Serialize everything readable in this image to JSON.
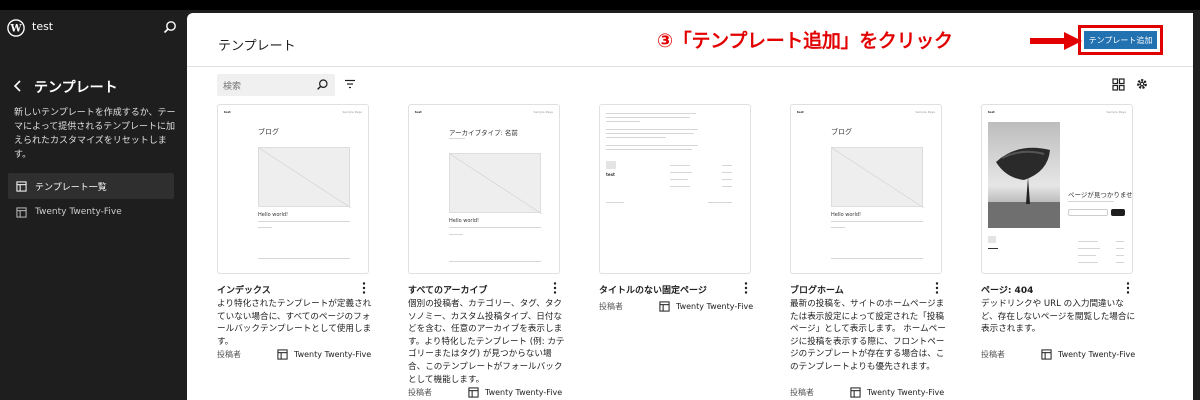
{
  "sidebar": {
    "site_name": "test",
    "title": "テンプレート",
    "description": "新しいテンプレートを作成するか、テーマによって提供されるテンプレートに加えられたカスタマイズをリセットします。",
    "nav": [
      {
        "label": "テンプレート一覧"
      },
      {
        "label": "Twenty Twenty-Five"
      }
    ]
  },
  "header": {
    "title": "テンプレート",
    "annotation": "③「テンプレート追加」をクリック",
    "add_button": "テンプレート追加"
  },
  "toolbar": {
    "search_placeholder": "検索"
  },
  "colors": {
    "accent": "#2271b1",
    "annotation_red": "#e30000",
    "sidebar_bg": "#1e1e1e"
  },
  "cards": [
    {
      "title": "インデックス",
      "description": "より特化されたテンプレートが定義されていない場合に、すべてのページのフォールバックテンプレートとして使用します。",
      "author": "投稿者",
      "theme": "Twenty Twenty-Five",
      "preview": {
        "site": "test",
        "nav": "Sample Page",
        "heading": "ブログ",
        "post_title": "Hello world!"
      }
    },
    {
      "title": "すべてのアーカイブ",
      "description": "個別の投稿者、カテゴリー、タグ、タクソノミー、カスタム投稿タイプ、日付などを含む、任意のアーカイブを表示します。より特化したテンプレート (例: カテゴリーまたはタグ) が見つからない場合、このテンプレートがフォールバックとして機能します。",
      "author": "投稿者",
      "theme": "Twenty Twenty-Five",
      "preview": {
        "site": "test",
        "nav": "Sample Page",
        "heading": "アーカイブタイプ: 名前",
        "post_title": "Hello world!"
      }
    },
    {
      "title": "タイトルのない固定ページ",
      "description": "",
      "author": "投稿者",
      "theme": "Twenty Twenty-Five",
      "preview": {
        "site": "test"
      }
    },
    {
      "title": "ブログホーム",
      "description": "最新の投稿を、サイトのホームページまたは表示設定によって設定された「投稿ページ」として表示します。 ホームページに投稿を表示する際に、フロントページのテンプレートが存在する場合は、このテンプレートよりも優先されます。",
      "author": "投稿者",
      "theme": "Twenty Twenty-Five",
      "preview": {
        "site": "test",
        "nav": "Sample Page",
        "heading": "ブログ",
        "post_title": "Hello world!"
      }
    },
    {
      "title": "ページ: 404",
      "description": "デッドリンクや URL の入力間違いなど、存在しないページを閲覧した場合に表示されます。",
      "author": "投稿者",
      "theme": "Twenty Twenty-Five",
      "preview": {
        "site": "test",
        "nav": "Sample Page",
        "heading": "ページが見つかりません"
      }
    }
  ]
}
